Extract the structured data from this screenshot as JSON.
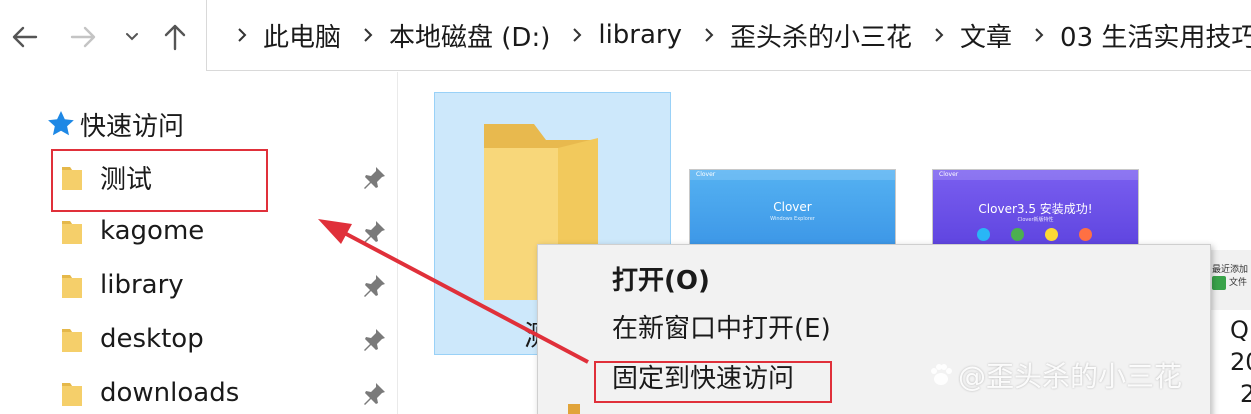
{
  "nav": {
    "back_icon": "arrow-left-icon",
    "forward_icon": "arrow-right-icon",
    "recent_icon": "chevron-down-icon",
    "up_icon": "arrow-up-icon"
  },
  "address_bar": {
    "crumbs": [
      "此电脑",
      "本地磁盘 (D:)",
      "library",
      "歪头杀的小三花",
      "文章",
      "03 生活实用技巧"
    ]
  },
  "sidebar": {
    "quick_access_label": "快速访问",
    "items": [
      {
        "label": "测试"
      },
      {
        "label": "kagome"
      },
      {
        "label": "library"
      },
      {
        "label": "desktop"
      },
      {
        "label": "downloads"
      }
    ]
  },
  "content": {
    "selected_folder_label": "测",
    "thumb1": {
      "bar": "Clover",
      "title": "Clover",
      "sub": "Windows Explorer"
    },
    "thumb2": {
      "bar": "Clover",
      "title": "Clover3.5 安装成功!",
      "sub": "Clover新版特性"
    },
    "thumb3": {
      "line1": "最近添加",
      "line2": "文件"
    },
    "right_frag": [
      "Q",
      "20",
      "2"
    ]
  },
  "context_menu": {
    "open": "打开(O)",
    "open_new_window": "在新窗口中打开(E)",
    "pin_quick_access": "固定到快速访问"
  },
  "watermark": "@歪头杀的小三花",
  "colors": {
    "highlight_red": "#e0303a",
    "selection_blue": "#cde8fb",
    "folder_yellow": "#f5cf6a"
  }
}
